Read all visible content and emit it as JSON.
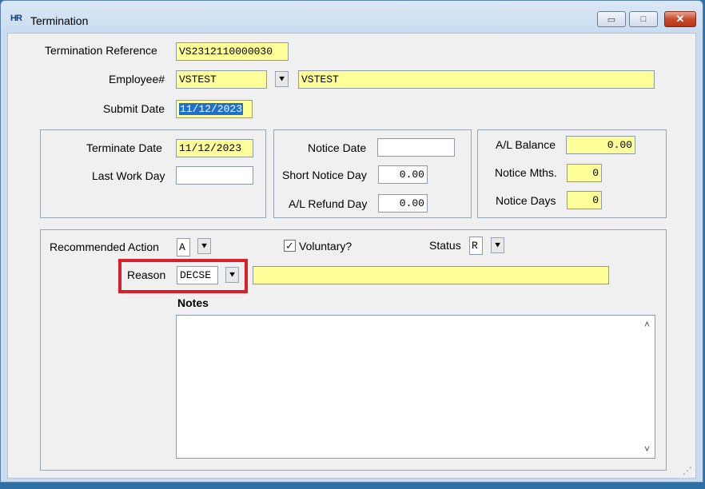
{
  "window": {
    "title": "Termination",
    "app_icon": "HR",
    "min_glyph": "▭",
    "max_glyph": "□",
    "close_glyph": "✕"
  },
  "header": {
    "termination_reference": {
      "label": "Termination Reference",
      "value": "VS2312110000030"
    },
    "employee": {
      "label": "Employee#",
      "code": "VSTEST",
      "name": "VSTEST"
    },
    "submit_date": {
      "label": "Submit Date",
      "value": "11/12/2023"
    }
  },
  "dates_panel": {
    "terminate_date": {
      "label": "Terminate Date",
      "value": "11/12/2023"
    },
    "last_work_day": {
      "label": "Last Work Day",
      "value": ""
    }
  },
  "notice_panel": {
    "notice_date": {
      "label": "Notice Date",
      "value": ""
    },
    "short_notice_day": {
      "label": "Short Notice Day",
      "value": "0.00"
    },
    "al_refund_day": {
      "label": "A/L Refund Day",
      "value": "0.00"
    }
  },
  "balance_panel": {
    "al_balance": {
      "label": "A/L Balance",
      "value": "0.00"
    },
    "notice_months": {
      "label": "Notice Mths.",
      "value": "0"
    },
    "notice_days": {
      "label": "Notice Days",
      "value": "0"
    }
  },
  "action_panel": {
    "recommended_action": {
      "label": "Recommended Action",
      "value": "A"
    },
    "voluntary": {
      "label": "Voluntary?",
      "checked": true,
      "check_glyph": "✓"
    },
    "status": {
      "label": "Status",
      "value": "R"
    },
    "reason": {
      "label": "Reason",
      "code": "DECSE",
      "description": ""
    },
    "notes": {
      "label": "Notes",
      "value": ""
    }
  },
  "icons": {
    "dropdown": "⯆",
    "scroll_up": "˄",
    "scroll_down": "˅",
    "resize_grip": "⋰"
  },
  "colors": {
    "required_field": "#ffff99",
    "highlight": "#d8202a",
    "selection": "#1e6fd0"
  }
}
